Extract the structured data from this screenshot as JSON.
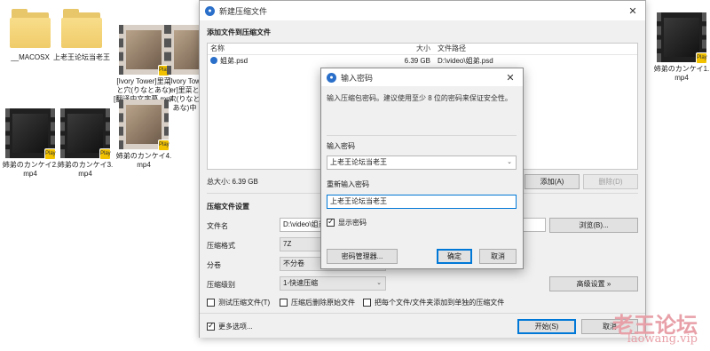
{
  "desktop": {
    "items": [
      {
        "label": "__MACOSX"
      },
      {
        "label": "上老王论坛当老王"
      },
      {
        "label": "[Ivory Tower]里菜と穴(りなとあな)[翻译中文字幕.mp4"
      },
      {
        "label": "[Ivory Tower]里菜と穴(りなとあな)中"
      },
      {
        "label": "姉弟のカンケイ1.mp4"
      },
      {
        "label": "姉弟のカンケイ2.mp4"
      },
      {
        "label": "姉弟のカンケイ3.mp4"
      },
      {
        "label": "姉弟のカンケイ4.mp4"
      }
    ],
    "badge": "Play"
  },
  "window": {
    "title": "新建压缩文件",
    "close": "✕",
    "add_section": "添加文件到压缩文件",
    "list_headers": {
      "name": "名称",
      "size": "大小",
      "path": "文件路径"
    },
    "files": [
      {
        "name": "姐弟.psd",
        "size": "6.39 GB",
        "path": "D:\\video\\姐弟.psd"
      }
    ],
    "total_size": "总大小: 6.39 GB",
    "add_button": "添加(A)",
    "delete_button": "删除(D)",
    "settings_section": "压缩文件设置",
    "filename_label": "文件名",
    "filename_value": "D:\\video\\姐弟",
    "browse_button": "浏览(B)...",
    "format_label": "压缩格式",
    "format_value": "7Z",
    "split_label": "分卷",
    "split_value": "不分卷",
    "level_label": "压缩级别",
    "level_value": "1-快速压缩",
    "advanced_button": "高级设置 »",
    "opt_test": "测试压缩文件(T)",
    "opt_delete": "压缩后删除原始文件",
    "opt_separate": "把每个文件/文件夹添加到单独的压缩文件",
    "more_options": "更多选项...",
    "start_button": "开始(S)",
    "cancel_button": "取消"
  },
  "dialog": {
    "title": "输入密码",
    "close": "✕",
    "hint": "输入压缩包密码。建议使用至少 8 位的密码来保证安全性。",
    "enter_label": "输入密码",
    "enter_value": "上老王论坛当老王",
    "reenter_label": "重新输入密码",
    "reenter_value": "上老王论坛当老王",
    "show_password": "显示密码",
    "manager_button": "密码管理器...",
    "ok_button": "确定",
    "cancel_button": "取消"
  },
  "watermark": {
    "cn": "老王论坛",
    "en": "laowang.vip"
  },
  "colors": {
    "accent": "#0078d7",
    "icon_blue": "#2a6fc9",
    "folder": "#f0cc6a",
    "watermark": "#e8a0a8"
  }
}
